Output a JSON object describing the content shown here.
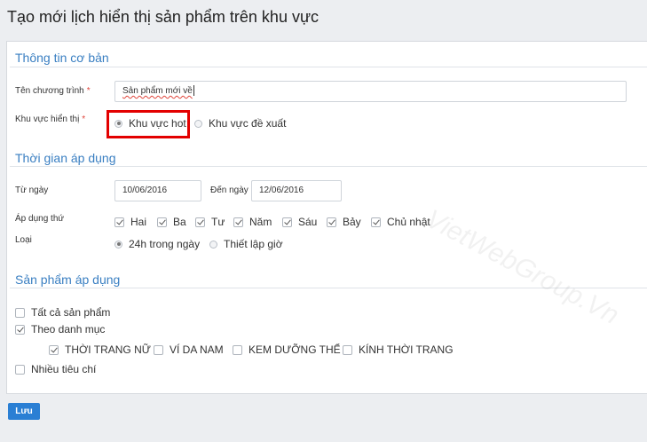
{
  "page": {
    "title": "Tạo mới lịch hiển thị sản phẩm trên khu vực"
  },
  "sections": {
    "basic": "Thông tin cơ bản",
    "time": "Thời gian áp dụng",
    "products": "Sản phẩm áp dụng"
  },
  "basic": {
    "name_label": "Tên chương trình",
    "required_mark": "*",
    "name_value": "Sản phẩm mới về",
    "area_label": "Khu vực hiển thị",
    "area_options": [
      {
        "label": "Khu vực hot",
        "selected": true
      },
      {
        "label": "Khu vực đề xuất",
        "selected": false
      }
    ]
  },
  "time": {
    "from_label": "Từ ngày",
    "from_value": "10/06/2016",
    "to_label": "Đến ngày",
    "to_value": "12/06/2016",
    "days_label": "Áp dụng thứ",
    "days": [
      {
        "label": "Hai",
        "checked": true
      },
      {
        "label": "Ba",
        "checked": true
      },
      {
        "label": "Tư",
        "checked": true
      },
      {
        "label": "Năm",
        "checked": true
      },
      {
        "label": "Sáu",
        "checked": true
      },
      {
        "label": "Bảy",
        "checked": true
      },
      {
        "label": "Chủ nhật",
        "checked": true
      }
    ],
    "type_label": "Loại",
    "type_options": [
      {
        "label": "24h trong ngày",
        "selected": true
      },
      {
        "label": "Thiết lập giờ",
        "selected": false
      }
    ]
  },
  "products": {
    "all": {
      "label": "Tất cả sản phẩm",
      "checked": false
    },
    "by_category": {
      "label": "Theo danh mục",
      "checked": true
    },
    "categories": [
      {
        "label": "THỜI TRANG NỮ",
        "checked": true
      },
      {
        "label": "VÍ DA NAM",
        "checked": false
      },
      {
        "label": "KEM DƯỠNG THỂ",
        "checked": false
      },
      {
        "label": "KÍNH THỜI TRANG",
        "checked": false
      }
    ],
    "multi": {
      "label": "Nhiều tiêu chí",
      "checked": false
    }
  },
  "watermark": "VietWebGroup.Vn",
  "actions": {
    "save_label": "Lưu"
  }
}
